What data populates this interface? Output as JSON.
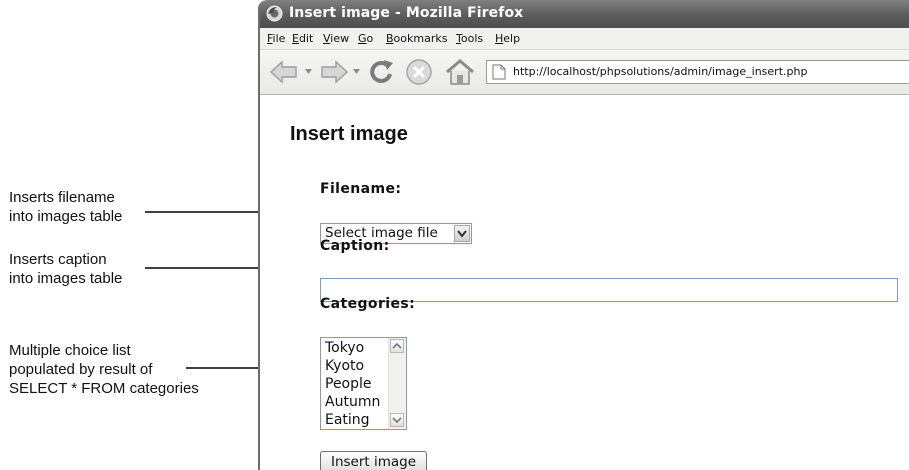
{
  "callouts": [
    {
      "line1": "Inserts filename",
      "line2": "into images table"
    },
    {
      "line1": "Inserts caption",
      "line2": "into images table"
    },
    {
      "line1": "Multiple choice list",
      "line2": "populated by result of",
      "line3": "SELECT * FROM categories"
    }
  ],
  "window": {
    "title": "Insert image - Mozilla Firefox",
    "menu": [
      {
        "u": "F",
        "rest": "ile"
      },
      {
        "u": "E",
        "rest": "dit"
      },
      {
        "u": "V",
        "rest": "iew"
      },
      {
        "u": "G",
        "rest": "o"
      },
      {
        "u": "B",
        "rest": "ookmarks"
      },
      {
        "u": "T",
        "rest": "ools"
      },
      {
        "u": "H",
        "rest": "elp"
      }
    ],
    "url": "http://localhost/phpsolutions/admin/image_insert.php",
    "nav_icons": [
      "back-arrow-icon",
      "forward-arrow-icon",
      "reload-icon",
      "stop-icon",
      "home-icon",
      "page-icon"
    ]
  },
  "form": {
    "page_title": "Insert image",
    "filename_label": "Filename:",
    "filename_value": "Select image file",
    "caption_label": "Caption:",
    "caption_value": "",
    "categories_label": "Categories:",
    "categories": [
      "Tokyo",
      "Kyoto",
      "People",
      "Autumn",
      "Eating"
    ],
    "submit_label": "Insert image"
  }
}
